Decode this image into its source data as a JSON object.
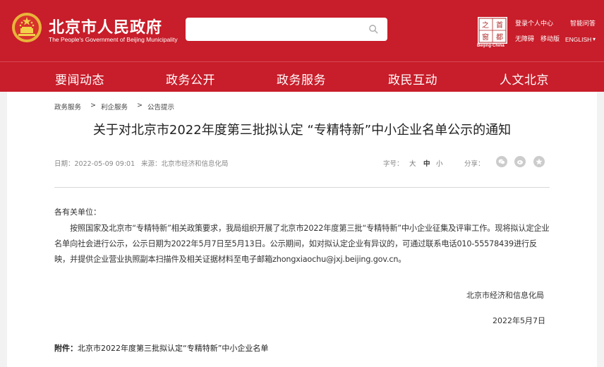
{
  "header": {
    "site_title": "北京市人民政府",
    "site_subtitle": "The People's Government of Beijing Municipality",
    "search": {
      "placeholder": ""
    },
    "logo_text_a": "首",
    "logo_text_b": "都",
    "logo_text_c": "之",
    "logo_text_d": "窗",
    "logo_caption": "Beijing·China",
    "utility_links": {
      "login": "登录个人中心",
      "qa": "智能问答",
      "accessible": "无障碍",
      "mobile": "移动版",
      "language": "ENGLISH"
    },
    "nav": [
      "要闻动态",
      "政务公开",
      "政务服务",
      "政民互动",
      "人文北京"
    ]
  },
  "breadcrumb": [
    "政务服务",
    "利企服务",
    "公告提示"
  ],
  "article": {
    "title": "关于对北京市2022年度第三批拟认定 “专精特新”中小企业名单公示的通知",
    "date": "日期：2022-05-09 09:01",
    "source": "来源：北京市经济和信息化局",
    "font_size_label": "字号：",
    "font_sizes": [
      "大",
      "中",
      "小"
    ],
    "share_label": "分享：",
    "greeting": "各有关单位：",
    "paragraph": "按照国家及北京市“专精特新”相关政策要求，我局组织开展了北京市2022年度第三批“专精特新”中小企业征集及评审工作。现将拟认定企业名单向社会进行公示，公示日期为2022年5月7日至5月13日。公示期间，如对拟认定企业有异议的，可通过联系电话010-55578439进行反映，并提供企业营业执照副本扫描件及相关证据材料至电子邮箱zhongxiaochu@jxj.beijing.gov.cn。",
    "signature": "北京市经济和信息化局",
    "sign_date": "2022年5月7日",
    "attachment_label": "附件：",
    "attachment_link": "北京市2022年度第三批拟认定“专精特新”中小企业名单"
  },
  "colors": {
    "brand_red": "#c81d2a",
    "page_bg": "#f2f2f2"
  },
  "icons": [
    "emblem-icon",
    "search-icon",
    "wechat-icon",
    "weibo-icon",
    "star-icon",
    "chevron-down-icon"
  ]
}
